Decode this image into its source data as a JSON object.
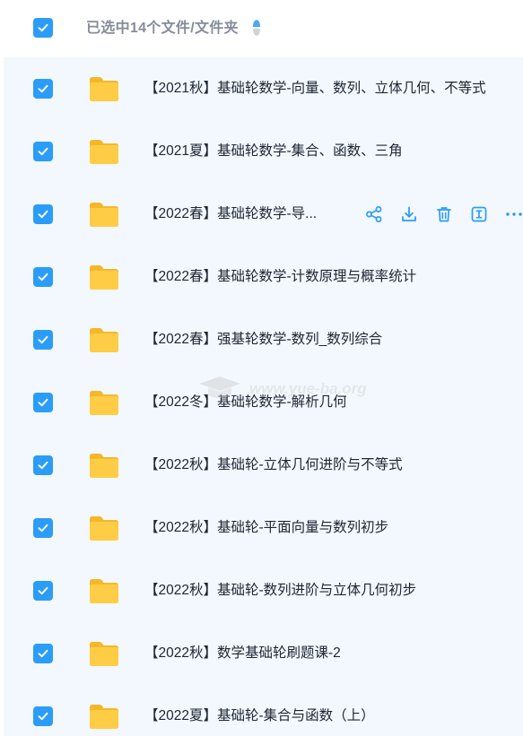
{
  "header": {
    "selection_text": "已选中14个文件/文件夹"
  },
  "files": [
    {
      "name": "【2021秋】基础轮数学-向量、数列、立体几何、不等式"
    },
    {
      "name": "【2021夏】基础轮数学-集合、函数、三角"
    },
    {
      "name": "【2022春】基础轮数学-导..."
    },
    {
      "name": "【2022春】基础轮数学-计数原理与概率统计"
    },
    {
      "name": "【2022春】强基轮数学-数列_数列综合"
    },
    {
      "name": "【2022冬】基础轮数学-解析几何"
    },
    {
      "name": "【2022秋】基础轮-立体几何进阶与不等式"
    },
    {
      "name": "【2022秋】基础轮-平面向量与数列初步"
    },
    {
      "name": "【2022秋】基础轮-数列进阶与立体几何初步"
    },
    {
      "name": "【2022秋】数学基础轮刷题课-2"
    },
    {
      "name": "【2022夏】基础轮-集合与函数（上）"
    }
  ],
  "row_actions": [
    "share-icon",
    "download-icon",
    "delete-icon",
    "rename-icon",
    "more-icon"
  ],
  "watermark": {
    "text": "www.yue-ba.org"
  },
  "colors": {
    "accent": "#2b9cf8",
    "folder": "#ffc93c",
    "list_bg": "#f2f8fd",
    "action_icon": "#2b9cf8"
  }
}
